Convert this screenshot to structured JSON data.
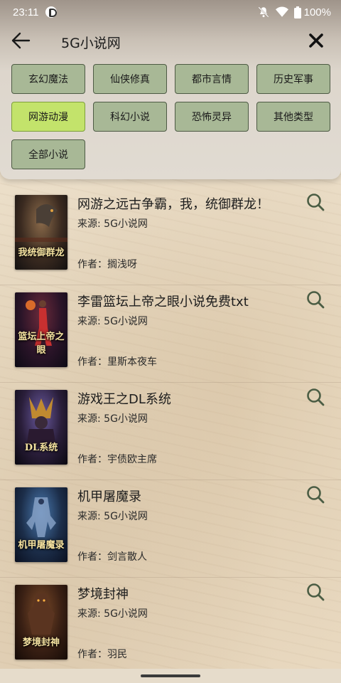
{
  "status_bar": {
    "time": "23:11",
    "battery": "100%"
  },
  "toolbar": {
    "search_query": "5G小说网",
    "back_icon": "arrow-left-icon",
    "close_icon": "close-icon"
  },
  "categories": [
    {
      "label": "玄幻魔法",
      "active": false
    },
    {
      "label": "仙侠修真",
      "active": false
    },
    {
      "label": "都市言情",
      "active": false
    },
    {
      "label": "历史军事",
      "active": false
    },
    {
      "label": "网游动漫",
      "active": true
    },
    {
      "label": "科幻小说",
      "active": false
    },
    {
      "label": "恐怖灵异",
      "active": false
    },
    {
      "label": "其他类型",
      "active": false
    },
    {
      "label": "全部小说",
      "active": false
    }
  ],
  "books": [
    {
      "title": "网游之远古争霸，我，统御群龙！",
      "source": "来源: 5G小说网",
      "author": "作者：搁浅呀",
      "cover_text": "我统御群龙"
    },
    {
      "title": "李雷篮坛上帝之眼小说免费txt",
      "source": "来源: 5G小说网",
      "author": "作者：里斯本夜车",
      "cover_text": "篮坛上帝之眼"
    },
    {
      "title": "游戏王之DL系统",
      "source": "来源: 5G小说网",
      "author": "作者：宇债欧主席",
      "cover_text": "DL系统"
    },
    {
      "title": "机甲屠魔录",
      "source": "来源: 5G小说网",
      "author": "作者：剑言散人",
      "cover_text": "机甲屠魔录"
    },
    {
      "title": "梦境封神",
      "source": "来源: 5G小说网",
      "author": "作者：羽民",
      "cover_text": "梦境封神"
    }
  ],
  "colors": {
    "chip_bg": "#a8b896",
    "chip_active_bg": "#c3e36b",
    "icon_green": "#4b5d44"
  }
}
